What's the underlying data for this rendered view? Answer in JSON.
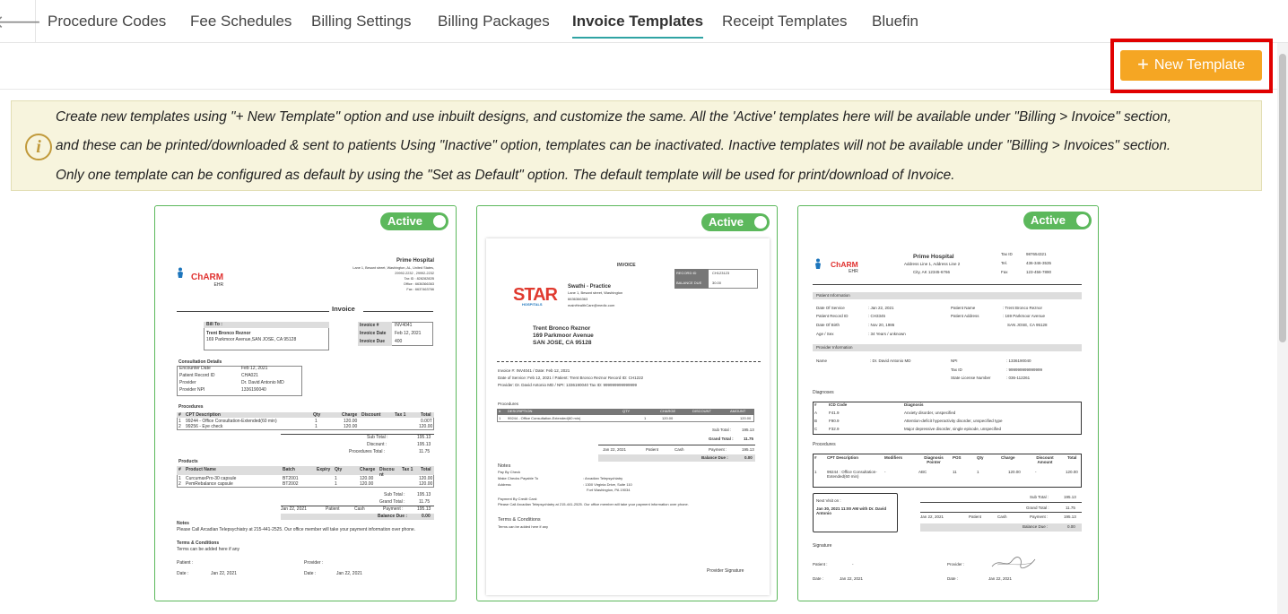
{
  "tabs": [
    "Procedure Codes",
    "Fee Schedules",
    "Billing Settings",
    "Billing Packages",
    "Invoice Templates",
    "Receipt Templates",
    "Bluefin"
  ],
  "active_tab": "Invoice Templates",
  "toolbar": {
    "new_template_label": "New Template"
  },
  "info": {
    "lines": [
      "Create new templates using \"+ New Template\" option and use inbuilt designs, and customize the same. All the 'Active' templates here will be available under \"Billing > Invoice\" section,",
      "and these can be printed/downloaded & sent to patients Using \"Inactive\" option, templates can be inactivated. Inactive templates will not be available under \"Billing > Invoices\" section.",
      "Only one template can be configured as default by using the \"Set as Default\" option. The default template will be used for print/download of Invoice."
    ]
  },
  "cards": [
    {
      "status": "Active",
      "hospital": "Prime Hospital",
      "address_lines": [
        "Lane 1, Besant street, Washington, AL, United States,",
        "29992-2232 , 29992-2232",
        "Tax ID : 82828282B",
        "Office : 6636366363",
        "Fax : 6637463766"
      ],
      "logo_text": "ChARM",
      "logo_sub": "EHR",
      "doc_title": "Invoice",
      "bill_to_label": "Bill To :",
      "bill_to": [
        "Trent Bronco Reznor",
        "169 Parkmoor Avenue,SAN JOSE, CA 95128"
      ],
      "invoice_meta": [
        [
          "Invoice #",
          "INV4041"
        ],
        [
          "Invoice Date",
          "Feb 12, 2021"
        ],
        [
          "Invoice Due",
          "400"
        ]
      ],
      "consultation_title": "Consultation Details",
      "consultation": [
        [
          "Encounter Date",
          "Feb 12, 2021"
        ],
        [
          "Patient Record ID",
          "CHA021"
        ],
        [
          "Provider",
          "Dr. David Antonio MD"
        ],
        [
          "Provider NPI",
          "1336190040"
        ]
      ],
      "procedures_title": "Procedures",
      "proc_headers": [
        "#",
        "CPT Description",
        "Qty",
        "Charge",
        "Discount",
        "Tax 1",
        "Total"
      ],
      "proc_rows": [
        [
          "1",
          "99244 - Office Consultation-Extended(60 min)",
          "1",
          "120.00",
          "-",
          "-",
          "0.00T"
        ],
        [
          "2",
          "99256 - Eye check",
          "1",
          "120.00",
          "-",
          "-",
          "120.00"
        ]
      ],
      "proc_totals": [
        [
          "Sub Total :",
          "195.13"
        ],
        [
          "Discount :",
          "195.13"
        ],
        [
          "Procedures Total :",
          "11.75"
        ]
      ],
      "products_title": "Products",
      "prod_headers": [
        "#",
        "Product Name",
        "Batch",
        "Expiry",
        "Qty",
        "Charge",
        "Discou nt",
        "Tax 1",
        "Total"
      ],
      "prod_rows": [
        [
          "1",
          "CurcumaxPro-30 capsule",
          "BT2001",
          "",
          "1",
          "120.00",
          "-",
          "",
          "120.00"
        ],
        [
          "2",
          "PemRebalance capsule",
          "BT2002",
          "",
          "1",
          "120.00",
          "-",
          "",
          "120.00"
        ]
      ],
      "prod_totals": [
        [
          "Sub Total :",
          "195.13"
        ],
        [
          "Grand Total :",
          "11.75"
        ]
      ],
      "pay_row": [
        "Jan 22, 2021",
        "Patient",
        "Cash",
        "Payment :",
        "195.13"
      ],
      "balance": [
        "Balance Due :",
        "0.00"
      ],
      "notes_title": "Notes",
      "notes": "Please Call Arcadian Telepsychiatry at 215-441-2525. Our office member will take your payment information over phone.",
      "terms_title": "Terms & Conditions",
      "terms": "Terms can be added here if any",
      "sign": [
        [
          "Patient :",
          "",
          "Provider :",
          ""
        ],
        [
          "Date :",
          "Jan 22, 2021",
          "Date :",
          "Jan 22, 2021"
        ]
      ]
    },
    {
      "status": "Active",
      "doc_title": "INVOICE",
      "logo_text": "STAR",
      "logo_sub": "HOSPITALS",
      "practice": "Swathi - Practice",
      "practice_lines": [
        "Lane 1, Besant street, Washington",
        "6636366363",
        "mainHealthCare@medic.com"
      ],
      "meta": [
        [
          "RECORD ID",
          "CH123123"
        ],
        [
          "BALANCE DUE",
          "30.00"
        ]
      ],
      "patient": [
        "Trent Bronco Reznor",
        "169 Parkmoor Avenue",
        "SAN JOSE, CA 95128"
      ],
      "inv_line1": "Invoice #: INV4041 / Date: Feb 12, 2021",
      "inv_line2": "Date of Service: Feb 12, 2021 / Patient: Trent Bronco Reznor Record ID: CH1222",
      "inv_line3": "Provider: Dr. David Antonio MD / NPI: 1336190040   Tax ID: 999999999999999",
      "procedures_title": "Procedures",
      "proc_headers": [
        "#",
        "DESCRIPTION",
        "QTY",
        "CHARGE",
        "DISCOUNT",
        "AMOUNT"
      ],
      "proc_rows": [
        [
          "1",
          "99244 - Office Consultation-Extended(60 min)",
          "1",
          "120.00",
          "",
          "120.00"
        ]
      ],
      "totals": [
        [
          "Sub Total :",
          "195.13"
        ],
        [
          "Grand Total :",
          "11.75"
        ]
      ],
      "pay_row": [
        "Jan 22, 2021",
        "Patient",
        "Cash",
        "Payment :",
        "195.13"
      ],
      "balance": [
        "Balance Due :",
        "0.00"
      ],
      "notes_title": "Notes",
      "pay_by": "Pay By Check",
      "checks_label": "Make Checks Payable To",
      "checks_value": ": Arcadian Telepsychiatry",
      "addr_label": "Address",
      "addr_lines": [
        ": 1300 Virginia Drive, Suite 110",
        "Fort Washington, PA 19034"
      ],
      "card_title": "Payment By Credit Card:",
      "card_text": "Please Call Arcadian Telepsychiatry at 215-441-2525. Our office member will take your payment information over phone.",
      "terms_title": "Terms & Conditions",
      "terms": "Terms can be added here if any",
      "signature": "Provider Signature"
    },
    {
      "status": "Active",
      "logo_text": "ChARM",
      "logo_sub": "EHR",
      "hospital": "Prime Hospital",
      "hosp_lines": [
        "Address Line 1, Address Line 2",
        "City, AK 12345-6766"
      ],
      "contact": [
        [
          "Tax ID",
          "987654321"
        ],
        [
          "Tel.",
          "436-346-3535"
        ],
        [
          "Fax",
          "123-456-7890"
        ]
      ],
      "pi_title": "Patient Information",
      "pi_left": [
        [
          "Date Of Service",
          ": Jan 22, 2021"
        ],
        [
          "Patient Record ID",
          ": CH3345"
        ],
        [
          "Date Of Birth",
          ": Nov 20, 1986"
        ],
        [
          "Age / Sex",
          ": 34 Years / unknown"
        ]
      ],
      "pi_right": [
        [
          "Patient Name",
          ": Trent Bronco Reznor"
        ],
        [
          "Patient Address",
          ": 169 Parkmoor Avenue"
        ],
        [
          "",
          "SAN JOSE, CA 95128"
        ]
      ],
      "prov_title": "Provider Information",
      "prov_name": [
        "Name",
        ": Dr. David Antonio MD"
      ],
      "prov_right": [
        [
          "NPI",
          ": 1336190040"
        ],
        [
          "Tax ID",
          ": 999999999999999"
        ],
        [
          "State License Number",
          ": 036-112261"
        ]
      ],
      "diag_title": "Diagnoses",
      "diag_headers": [
        "#",
        "ICD Code",
        "Diagnosis"
      ],
      "diag_rows": [
        [
          "A",
          "F41.9",
          "Anxiety disorder, unspecified"
        ],
        [
          "B",
          "F90.9",
          "Attention-deficit hyperactivity disorder, unspecified type"
        ],
        [
          "C",
          "F32.9",
          "Major depressive disorder, single episode, unspecified"
        ]
      ],
      "proc_title": "Procedures",
      "proc_headers": [
        "#",
        "CPT Description",
        "Modifiers",
        "Diagnosis Pointer",
        "POS",
        "Qty",
        "Charge",
        "Discount Amount",
        "Total"
      ],
      "proc_row": [
        "1",
        "99244 : Office Consultation-Extended(60 min)",
        "-",
        "ABC",
        "11",
        "1",
        "120.00",
        "-",
        "120.00"
      ],
      "next_visit_label": "Next Visit on :",
      "next_visit": "Jan 30, 2021 11:00 AM with Dr. David Antonio",
      "totals": [
        [
          "Sub Total :",
          "195.13"
        ],
        [
          "Grand Total :",
          "11.75"
        ]
      ],
      "pay_row": [
        "Jan 22, 2021",
        "Patient",
        "Cash",
        "Payment :",
        "195.13"
      ],
      "balance": [
        "Balance Due :",
        "0.00"
      ],
      "signature_title": "Signature",
      "sign": [
        [
          "Patient :",
          "-",
          "Provider :",
          ""
        ],
        [
          "Date :",
          "Jan 22, 2021",
          "Date :",
          "Jan 22, 2021"
        ]
      ]
    }
  ]
}
